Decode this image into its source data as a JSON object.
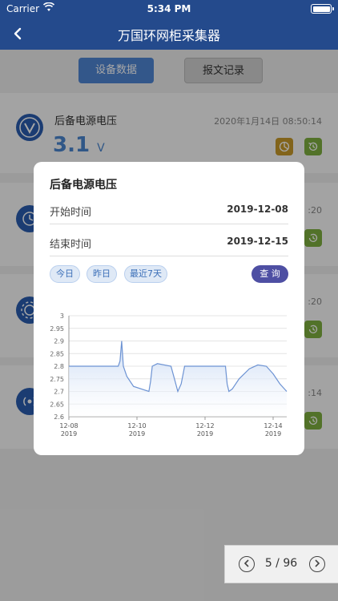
{
  "status_bar": {
    "carrier": "Carrier",
    "time": "5:34 PM"
  },
  "nav": {
    "back_icon": "chevron-left-icon",
    "title": "万国环网柜采集器"
  },
  "tabs": [
    {
      "label": "设备数据",
      "active": true
    },
    {
      "label": "报文记录",
      "active": false
    }
  ],
  "card": {
    "name": "后备电源电压",
    "timestamp": "2020年1月14日 08:50:14",
    "value": "3.1",
    "unit": "V"
  },
  "background_partial": {
    "ts_fragments": [
      ":20",
      ":20",
      ":14"
    ]
  },
  "pager": {
    "current": "5 / 96"
  },
  "modal": {
    "title": "后备电源电压",
    "start_label": "开始时间",
    "start_value": "2019-12-08",
    "end_label": "结束时间",
    "end_value": "2019-12-15",
    "quick_ranges": [
      "今日",
      "昨日",
      "最近7天"
    ],
    "query_label": "查 询"
  },
  "colors": {
    "nav_bg": "#244a8c",
    "accent_blue": "#4f86d4",
    "query_btn": "#4e4fa3",
    "chart_line": "#6d93d3",
    "chart_fill": "#c6d8f3"
  },
  "chart_data": {
    "type": "area",
    "title": "",
    "xlabel": "",
    "ylabel": "",
    "ylim": [
      2.6,
      3.0
    ],
    "yticks": [
      "2.6",
      "2.65",
      "2.7",
      "2.75",
      "2.8",
      "2.85",
      "2.9",
      "2.95",
      "3"
    ],
    "xticks": [
      {
        "x": 0,
        "label": "12-08",
        "sub": "2019"
      },
      {
        "x": 2,
        "label": "12-10",
        "sub": "2019"
      },
      {
        "x": 4,
        "label": "12-12",
        "sub": "2019"
      },
      {
        "x": 6,
        "label": "12-14",
        "sub": "2019"
      }
    ],
    "xlim": [
      0,
      6.4
    ],
    "grid": true,
    "series": [
      {
        "points": [
          [
            0,
            2.8
          ],
          [
            0.7,
            2.8
          ],
          [
            1.45,
            2.8
          ],
          [
            1.5,
            2.82
          ],
          [
            1.55,
            2.9
          ],
          [
            1.6,
            2.8
          ],
          [
            1.7,
            2.76
          ],
          [
            1.9,
            2.72
          ],
          [
            2.35,
            2.7
          ],
          [
            2.4,
            2.74
          ],
          [
            2.45,
            2.8
          ],
          [
            2.6,
            2.81
          ],
          [
            3.0,
            2.8
          ],
          [
            3.1,
            2.75
          ],
          [
            3.2,
            2.7
          ],
          [
            3.3,
            2.73
          ],
          [
            3.4,
            2.8
          ],
          [
            3.6,
            2.8
          ],
          [
            4.0,
            2.8
          ],
          [
            4.6,
            2.8
          ],
          [
            4.65,
            2.73
          ],
          [
            4.7,
            2.7
          ],
          [
            4.8,
            2.71
          ],
          [
            5.0,
            2.75
          ],
          [
            5.3,
            2.79
          ],
          [
            5.55,
            2.805
          ],
          [
            5.8,
            2.8
          ],
          [
            6.0,
            2.77
          ],
          [
            6.2,
            2.73
          ],
          [
            6.4,
            2.7
          ]
        ]
      }
    ]
  }
}
